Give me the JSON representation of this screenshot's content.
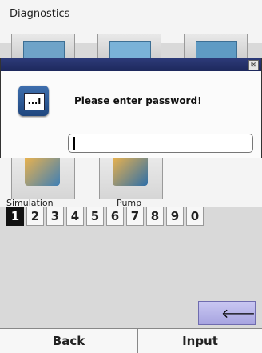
{
  "header": {
    "title": "Diagnostics"
  },
  "tiles": {
    "simulation_label": "Simulation",
    "pump_label": "Pump"
  },
  "dialog": {
    "message": "Please enter password!",
    "icon_text": "...I",
    "close_glyph": "⊠",
    "password_value": ""
  },
  "keypad": {
    "digits": [
      "1",
      "2",
      "3",
      "4",
      "5",
      "6",
      "7",
      "8",
      "9",
      "0"
    ],
    "active_digit": "1",
    "symbols": [
      "-",
      ","
    ],
    "backspace_glyph": "🡐"
  },
  "bottom_bar": {
    "back_label": "Back",
    "input_label": "Input"
  }
}
